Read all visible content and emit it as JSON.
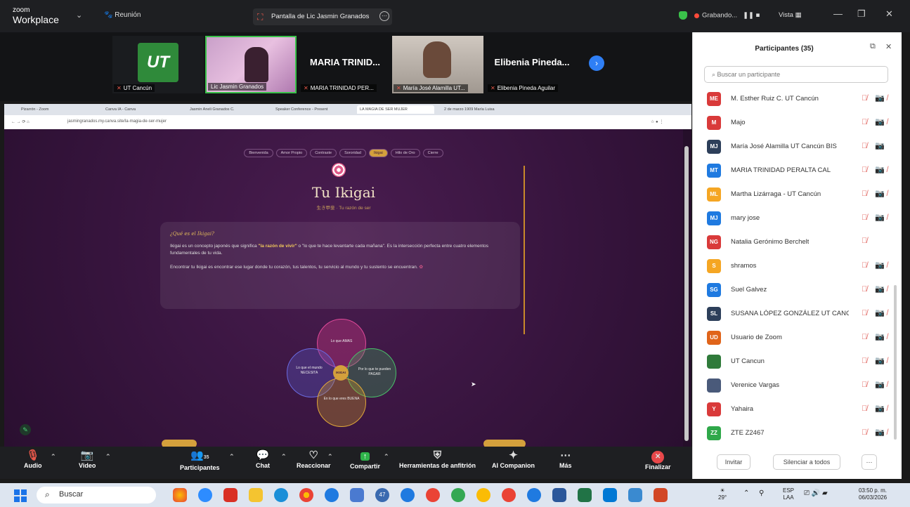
{
  "topbar": {
    "logo_small": "zoom",
    "logo_big": "Workplace",
    "meeting_label": "Reunión",
    "share_label": "Pantalla de Lic Jasmin Granados",
    "recording_label": "Grabando...",
    "view_label": "Vista"
  },
  "strip": {
    "tiles": [
      {
        "name": "",
        "label": "UT Cancún"
      },
      {
        "name": "",
        "label": "Lic Jasmin Granados"
      },
      {
        "name": "MARIA TRINID...",
        "label": "MARIA TRINIDAD PER..."
      },
      {
        "name": "",
        "label": "María José Alamilla UT..."
      },
      {
        "name": "Elibenia Pineda...",
        "label": "Elibenia Pineda Aguilar"
      }
    ]
  },
  "browser": {
    "tabs": [
      "Pizarrón - Zoom",
      "Canva IA - Canva",
      "Jasmin Aneli Granados C.",
      "Speaker Conference - Present",
      "LA MAGIA DE SER MUJER",
      "2 de marzo 1909 María Luisa"
    ],
    "url": "jasmingranados.my.canva.site/la-magia-de-ser-mujer"
  },
  "page": {
    "nav": [
      "Bienvenida",
      "Amor Propio",
      "Contraste",
      "Sororidad",
      "Ikigai",
      "Hilo de Oro",
      "Cierre"
    ],
    "active_nav": "Ikigai",
    "title": "Tu Ikigai",
    "subtitle": "生き甲斐 · Tu razón de ser",
    "card_heading": "¿Qué es el Ikigai?",
    "card_p1_a": "Ikigai es un concepto japonés que significa ",
    "card_p1_b": "\"la razón de vivir\"",
    "card_p1_c": " o \"lo que te hace levantarte cada mañana\". Es la intersección perfecta entre cuatro elementos fundamentales de tu vida.",
    "card_p2": "Encontrar tu Ikigai es encontrar ese lugar donde tu corazón, tus talentos, tu servicio al mundo y tu sustento se encuentran.",
    "venn": {
      "top": "Lo que AMAS",
      "left": "Lo que el mundo NECESITA",
      "right": "Por lo que te pueden PAGAR",
      "bottom": "En lo que eres BUENA",
      "center": "IKIGAI"
    }
  },
  "toolbar": {
    "audio": "Audio",
    "video": "Video",
    "participants": "Participantes",
    "participants_count": "35",
    "chat": "Chat",
    "react": "Reaccionar",
    "share": "Compartir",
    "host_tools": "Herramientas de anfitrión",
    "ai": "AI Companion",
    "more": "Más",
    "end": "Finalizar"
  },
  "panel": {
    "title": "Participantes (35)",
    "search_placeholder": "Buscar un participante",
    "participants": [
      {
        "initials": "ME",
        "name": "M. Esther Ruiz C. UT Cancún",
        "color": "#d93a3a",
        "icons": "🎙̸ 📷̸"
      },
      {
        "initials": "M",
        "name": "Majo",
        "color": "#d93a3a",
        "icons": "🎙̸ 📷̸"
      },
      {
        "initials": "MJ",
        "name": "María José Alamilla UT Cancún BIS",
        "color": "#2d3f5a",
        "icons": "🎙̸ 📷"
      },
      {
        "initials": "MT",
        "name": "MARIA TRINIDAD PERALTA CAL",
        "color": "#1f7ae0",
        "icons": "🎙̸ 📷̸"
      },
      {
        "initials": "ML",
        "name": "Martha Lizárraga - UT Cancún",
        "color": "#f5a623",
        "icons": "🎙̸ 📷̸"
      },
      {
        "initials": "MJ",
        "name": "mary jose",
        "color": "#1f7ae0",
        "icons": "🎙̸ 📷̸"
      },
      {
        "initials": "NG",
        "name": "Natalia Gerónimo Berchelt",
        "color": "#d93a3a",
        "icons": "🎙̸"
      },
      {
        "initials": "S",
        "name": "shramos",
        "color": "#f5a623",
        "icons": "🎙̸ 📷̸"
      },
      {
        "initials": "SG",
        "name": "Suel Galvez",
        "color": "#1f7ae0",
        "icons": "🎙̸ 📷̸"
      },
      {
        "initials": "SL",
        "name": "SUSANA LÓPEZ GONZÁLEZ UT CANC...",
        "color": "#2d3f5a",
        "icons": "🎙̸ 📷̸"
      },
      {
        "initials": "UD",
        "name": "Usuario de Zoom",
        "color": "#e0641a",
        "icons": "🎙̸ 📷̸"
      },
      {
        "initials": "",
        "name": "UT Cancun",
        "color": "#2f7a3a",
        "icons": "🎙̸ 📷̸"
      },
      {
        "initials": "",
        "name": "Verenice Vargas",
        "color": "#4a5a7a",
        "icons": "🎙̸ 📷̸"
      },
      {
        "initials": "Y",
        "name": "Yahaira",
        "color": "#d93a3a",
        "icons": "🎙̸ 📷̸"
      },
      {
        "initials": "ZZ",
        "name": "ZTE Z2467",
        "color": "#2fa84a",
        "icons": "🎙̸ 📷̸"
      }
    ],
    "invite": "Invitar",
    "mute_all": "Silenciar a todos",
    "more": "···"
  },
  "taskbar": {
    "search": "Buscar",
    "badge": "47",
    "temp": "29°",
    "lang1": "ESP",
    "lang2": "LAA",
    "time": "03:50 p. m.",
    "date": "06/03/2026"
  }
}
